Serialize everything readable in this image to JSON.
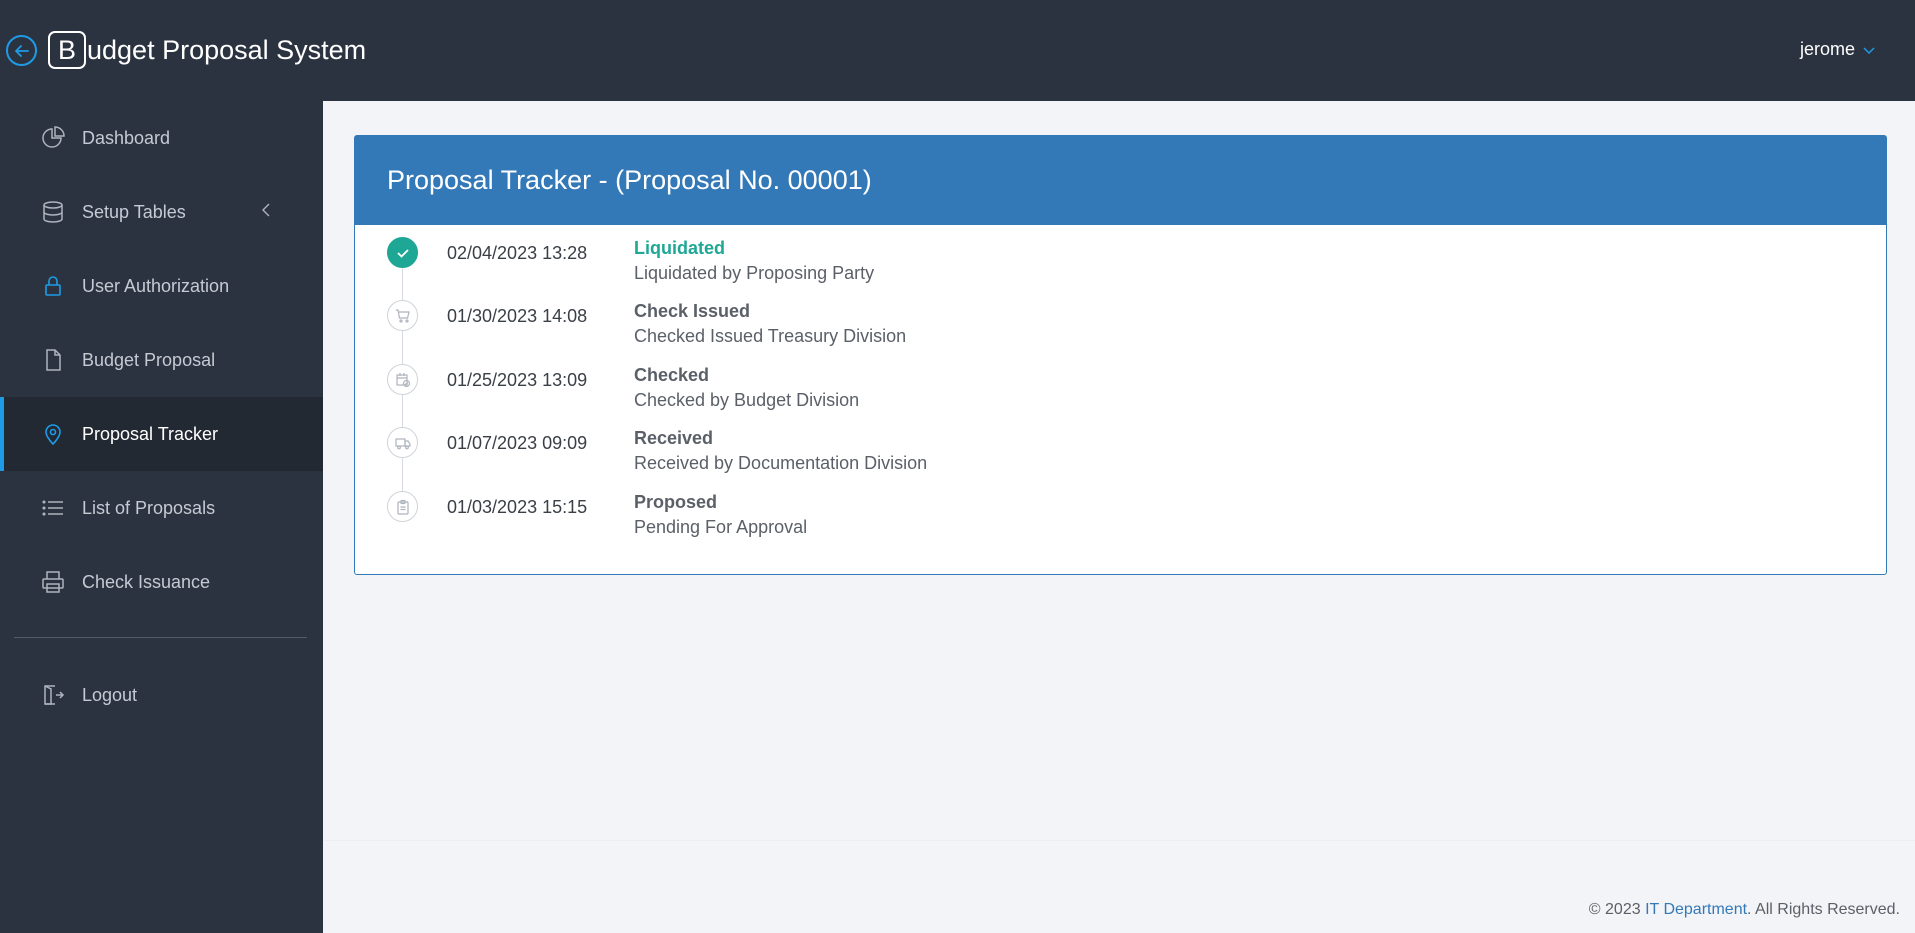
{
  "header": {
    "brand_letter": "B",
    "brand_rest": "udget Proposal System",
    "user_name": "jerome"
  },
  "sidebar": {
    "items": [
      {
        "label": "Dashboard",
        "icon": "pie-chart-icon"
      },
      {
        "label": "Setup Tables",
        "icon": "database-icon"
      },
      {
        "label": "User Authorization",
        "icon": "lock-icon"
      },
      {
        "label": "Budget Proposal",
        "icon": "file-icon"
      },
      {
        "label": "Proposal Tracker",
        "icon": "map-pin-icon",
        "active": true
      },
      {
        "label": "List of Proposals",
        "icon": "list-icon"
      },
      {
        "label": "Check Issuance",
        "icon": "printer-icon"
      },
      {
        "label": "Logout",
        "icon": "logout-icon"
      }
    ]
  },
  "tracker": {
    "title": "Proposal Tracker - (Proposal No. 00001)",
    "events": [
      {
        "date": "02/04/2023 13:28",
        "status": "Liquidated",
        "desc": "Liquidated by Proposing Party",
        "icon": "check-icon",
        "done": true
      },
      {
        "date": "01/30/2023 14:08",
        "status": "Check Issued",
        "desc": "Checked Issued Treasury Division",
        "icon": "cart-icon"
      },
      {
        "date": "01/25/2023 13:09",
        "status": "Checked",
        "desc": "Checked by Budget Division",
        "icon": "calendar-check-icon"
      },
      {
        "date": "01/07/2023 09:09",
        "status": "Received",
        "desc": "Received by Documentation Division",
        "icon": "truck-icon"
      },
      {
        "date": "01/03/2023 15:15",
        "status": "Proposed",
        "desc": "Pending For Approval",
        "icon": "clipboard-icon"
      }
    ]
  },
  "footer": {
    "prefix": "© 2023 ",
    "link": "IT Department",
    "suffix": ". All Rights Reserved."
  },
  "colors": {
    "sidebar_bg": "#2c3340",
    "accent": "#1e9be6",
    "card_header": "#3479b7",
    "done": "#1fa795"
  }
}
